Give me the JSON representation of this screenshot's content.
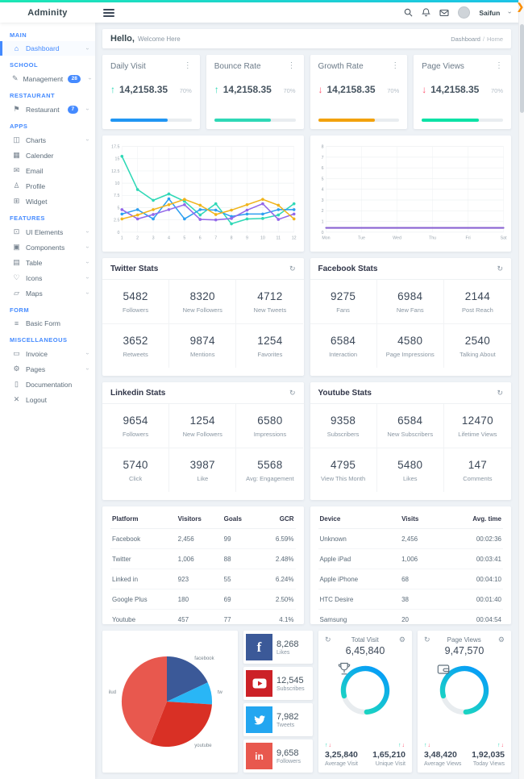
{
  "brand": "Adminity",
  "header": {
    "user": "Saifun"
  },
  "greeting": {
    "hello": "Hello,",
    "welcome": "Welcome Here"
  },
  "breadcrumb": {
    "items": [
      "Dashboard",
      "Home"
    ],
    "separator": "/"
  },
  "sidebar": {
    "sections": [
      {
        "label": "MAIN",
        "items": [
          {
            "label": "Dashboard",
            "icon": "home-icon",
            "active": true,
            "chevron": true
          }
        ]
      },
      {
        "label": "SCHOOL",
        "items": [
          {
            "label": "Management",
            "icon": "edit-icon",
            "badge": "28",
            "chevron": true
          }
        ]
      },
      {
        "label": "RESTAURANT",
        "items": [
          {
            "label": "Restaurant",
            "icon": "shield-icon",
            "badge": "7",
            "chevron": true
          }
        ]
      },
      {
        "label": "APPS",
        "items": [
          {
            "label": "Charts",
            "icon": "chart-icon",
            "chevron": true
          },
          {
            "label": "Calender",
            "icon": "calendar-icon"
          },
          {
            "label": "Email",
            "icon": "mail-icon"
          },
          {
            "label": "Profile",
            "icon": "user-icon"
          },
          {
            "label": "Widget",
            "icon": "widget-icon"
          }
        ]
      },
      {
        "label": "FEATURES",
        "items": [
          {
            "label": "UI Elements",
            "icon": "layers-icon",
            "chevron": true
          },
          {
            "label": "Components",
            "icon": "components-icon",
            "chevron": true
          },
          {
            "label": "Table",
            "icon": "table-icon",
            "chevron": true
          },
          {
            "label": "Icons",
            "icon": "heart-icon",
            "chevron": true
          },
          {
            "label": "Maps",
            "icon": "map-icon",
            "chevron": true
          }
        ]
      },
      {
        "label": "FORM",
        "items": [
          {
            "label": "Basic Form",
            "icon": "form-icon"
          }
        ]
      },
      {
        "label": "MISCELLANEOUS",
        "items": [
          {
            "label": "Invoice",
            "icon": "invoice-icon",
            "chevron": true
          },
          {
            "label": "Pages",
            "icon": "pages-icon",
            "chevron": true
          },
          {
            "label": "Documentation",
            "icon": "document-icon"
          },
          {
            "label": "Logout",
            "icon": "logout-icon"
          }
        ]
      }
    ]
  },
  "stat_cards": [
    {
      "title": "Daily Visit",
      "value": "14,2158.35",
      "percent": "70%",
      "direction": "up",
      "bar_color": "#2196f3",
      "bar_pct": 70
    },
    {
      "title": "Bounce Rate",
      "value": "14,2158.35",
      "percent": "70%",
      "direction": "up",
      "bar_color": "#2ed8b6",
      "bar_pct": 70
    },
    {
      "title": "Growth Rate",
      "value": "14,2158.35",
      "percent": "70%",
      "direction": "down",
      "bar_color": "#f2a20d",
      "bar_pct": 70
    },
    {
      "title": "Page Views",
      "value": "14,2158.35",
      "percent": "70%",
      "direction": "down",
      "bar_color": "#0ce2a6",
      "bar_pct": 70
    }
  ],
  "arrow_colors": {
    "up": "#2ed8b6",
    "down": "#ff5370"
  },
  "chart_data": [
    {
      "type": "line",
      "x": [
        1,
        2,
        3,
        4,
        5,
        6,
        7,
        8,
        9,
        10,
        11,
        12
      ],
      "ylim": [
        0,
        17.5
      ],
      "yticks": [
        0,
        2.5,
        5,
        7.5,
        10,
        12.5,
        15,
        17.5
      ],
      "grid": true,
      "legend": "none",
      "series": [
        {
          "name": "teal",
          "color": "#2ed8b6",
          "values": [
            15.5,
            8.7,
            6.5,
            7.8,
            6.3,
            3.5,
            5.8,
            1.7,
            2.7,
            2.8,
            3.5,
            5.8
          ]
        },
        {
          "name": "blue",
          "color": "#2d9ff0",
          "values": [
            3.7,
            4.6,
            2.7,
            6.8,
            2.7,
            4.6,
            4.5,
            3.2,
            3.7,
            3.7,
            4.6,
            4.6
          ]
        },
        {
          "name": "purple",
          "color": "#9368e9",
          "values": [
            4.6,
            2.7,
            3.6,
            4.6,
            5.6,
            2.6,
            2.5,
            2.8,
            4.5,
            5.8,
            2.6,
            3.7
          ]
        },
        {
          "name": "orange",
          "color": "#f0b41c",
          "values": [
            2.7,
            3.5,
            4.6,
            5.6,
            6.7,
            5.5,
            3.6,
            4.5,
            5.6,
            6.7,
            5.5,
            2.7
          ]
        }
      ]
    },
    {
      "type": "line",
      "x": [
        "Mon",
        "Tue",
        "Wed",
        "Thu",
        "Fri",
        "Sat"
      ],
      "ylim": [
        0,
        8
      ],
      "yticks": [
        0,
        1,
        2,
        3,
        4,
        5,
        6,
        7,
        8
      ],
      "grid": true,
      "legend": "none",
      "series": [
        {
          "name": "weekly",
          "color": "#8a63d2",
          "values": [
            0.4,
            0.4,
            0.4,
            0.4,
            0.4,
            0.4
          ]
        }
      ]
    },
    {
      "type": "pie",
      "slices": [
        {
          "label": "facebook",
          "value": 18,
          "color": "#3b5998"
        },
        {
          "label": "tw",
          "value": 8,
          "color": "#29b6f6"
        },
        {
          "label": "youtube",
          "value": 30,
          "color": "#d93025"
        },
        {
          "label": "ilud",
          "value": 44,
          "color": "#e8584e"
        }
      ]
    }
  ],
  "stats_panels": [
    {
      "title": "Twitter Stats",
      "cells": [
        {
          "value": "5482",
          "label": "Followers"
        },
        {
          "value": "8320",
          "label": "New Followers"
        },
        {
          "value": "4712",
          "label": "New Tweets"
        },
        {
          "value": "3652",
          "label": "Retweets"
        },
        {
          "value": "9874",
          "label": "Mentions"
        },
        {
          "value": "1254",
          "label": "Favorites"
        }
      ]
    },
    {
      "title": "Facebook Stats",
      "cells": [
        {
          "value": "9275",
          "label": "Fans"
        },
        {
          "value": "6984",
          "label": "New Fans"
        },
        {
          "value": "2144",
          "label": "Post Reach"
        },
        {
          "value": "6584",
          "label": "Interaction"
        },
        {
          "value": "4580",
          "label": "Page Impressions"
        },
        {
          "value": "2540",
          "label": "Talking About"
        }
      ]
    },
    {
      "title": "Linkedin Stats",
      "cells": [
        {
          "value": "9654",
          "label": "Followers"
        },
        {
          "value": "1254",
          "label": "New Followers"
        },
        {
          "value": "6580",
          "label": "Impressions"
        },
        {
          "value": "5740",
          "label": "Click"
        },
        {
          "value": "3987",
          "label": "Like"
        },
        {
          "value": "5568",
          "label": "Avg: Engagement"
        }
      ]
    },
    {
      "title": "Youtube Stats",
      "cells": [
        {
          "value": "9358",
          "label": "Subscribers"
        },
        {
          "value": "6584",
          "label": "New Subscribers"
        },
        {
          "value": "12470",
          "label": "Lifetime Views"
        },
        {
          "value": "4795",
          "label": "View This Month"
        },
        {
          "value": "5480",
          "label": "Likes"
        },
        {
          "value": "147",
          "label": "Comments"
        }
      ]
    }
  ],
  "tables": [
    {
      "name": "platform-table",
      "headers": [
        "Platform",
        "Visitors",
        "Goals",
        "GCR"
      ],
      "rows": [
        [
          "Facebook",
          "2,456",
          "99",
          "6.59%"
        ],
        [
          "Twitter",
          "1,006",
          "88",
          "2.48%"
        ],
        [
          "Linked in",
          "923",
          "55",
          "6.24%"
        ],
        [
          "Google Plus",
          "180",
          "69",
          "2.50%"
        ],
        [
          "Youtube",
          "457",
          "77",
          "4.1%"
        ]
      ]
    },
    {
      "name": "device-table",
      "headers": [
        "Device",
        "Visits",
        "Avg. time"
      ],
      "rows": [
        [
          "Unknown",
          "2,456",
          "00:02:36"
        ],
        [
          "Apple iPad",
          "1,006",
          "00:03:41"
        ],
        [
          "Apple iPhone",
          "68",
          "00:04:10"
        ],
        [
          "HTC Desire",
          "38",
          "00:01:40"
        ],
        [
          "Samsung",
          "20",
          "00:04:54"
        ]
      ]
    }
  ],
  "social_buttons": [
    {
      "network": "facebook",
      "value": "8,268",
      "label": "Likes",
      "color": "#3b5998"
    },
    {
      "network": "youtube",
      "value": "12,545",
      "label": "Subscribes",
      "color": "#cc2127"
    },
    {
      "network": "twitter",
      "value": "7,982",
      "label": "Tweets",
      "color": "#23a6f0"
    },
    {
      "network": "linkedin",
      "value": "9,658",
      "label": "Followers",
      "color": "#e8584e"
    }
  ],
  "gauge_cards": [
    {
      "title": "Total Visit",
      "value": "6,45,840",
      "icon": "trophy-icon",
      "percent": 78,
      "left": {
        "value": "3,25,840",
        "label": "Average Visit"
      },
      "right": {
        "value": "1,65,210",
        "label": "Unique Visit"
      }
    },
    {
      "title": "Page Views",
      "value": "9,47,570",
      "icon": "wallet-icon",
      "percent": 78,
      "left": {
        "value": "3,48,420",
        "label": "Average Views"
      },
      "right": {
        "value": "1,92,035",
        "label": "Today Views"
      }
    }
  ],
  "gauge_gradient": [
    "#0496ff",
    "#20e2b4"
  ]
}
